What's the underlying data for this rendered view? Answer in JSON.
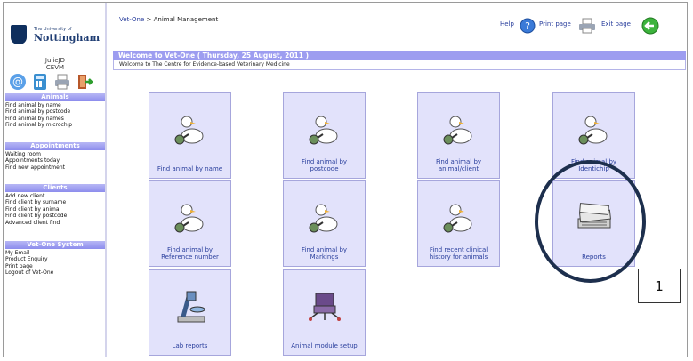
{
  "logo": {
    "small": "The University of",
    "big": "Nottingham"
  },
  "user": {
    "name": "JulieJD",
    "dept": "CEVM"
  },
  "quick_icons": [
    "email-icon",
    "calculator-icon",
    "printer-icon",
    "logout-icon"
  ],
  "sidebar": {
    "sections": [
      {
        "title": "Animals",
        "items": [
          "Find animal by name",
          "Find animal by postcode",
          "Find animal by names",
          "Find animal by microchip"
        ]
      },
      {
        "title": "Appointments",
        "items": [
          "Waiting room",
          "Appointments today",
          "Find new appointment"
        ]
      },
      {
        "title": "Clients",
        "items": [
          "Add new client",
          "Find client by surname",
          "Find client by animal",
          "Find client by postcode",
          "Advanced client find"
        ]
      },
      {
        "title": "Vet-One System",
        "items": [
          "My Email",
          "Product Enquiry",
          "Print page",
          "Logout of Vet-One"
        ]
      }
    ]
  },
  "breadcrumb": {
    "link": "Vet-One",
    "sep": ">",
    "current": "Animal Management"
  },
  "toplinks": {
    "help": "Help",
    "print": "Print page",
    "exit": "Exit page"
  },
  "welcome": {
    "title": "Welcome to Vet-One ( Thursday, 25 August, 2011 )",
    "message": "Welcome to The Centre for Evidence-based Veterinary Medicine"
  },
  "tiles": [
    {
      "line1": "Find animal by name",
      "line2": "",
      "icon": "duck-magnifier-icon"
    },
    {
      "line1": "Find animal by",
      "line2": "postcode",
      "icon": "duck-magnifier-icon"
    },
    {
      "line1": "Find animal by",
      "line2": "animal/client",
      "icon": "duck-magnifier-icon"
    },
    {
      "line1": "Find animal by",
      "line2": "Identichip",
      "icon": "duck-magnifier-icon"
    },
    {
      "line1": "Find animal by",
      "line2": "Reference number",
      "icon": "duck-magnifier-icon"
    },
    {
      "line1": "Find animal by",
      "line2": "Markings",
      "icon": "duck-magnifier-icon"
    },
    {
      "line1": "Find recent clinical",
      "line2": "history for animals",
      "icon": "duck-magnifier-icon"
    },
    {
      "line1": "Reports",
      "line2": "",
      "icon": "reports-icon"
    },
    {
      "line1": "Lab reports",
      "line2": "",
      "icon": "microscope-icon"
    },
    {
      "line1": "Animal module setup",
      "line2": "",
      "icon": "setup-icon"
    }
  ],
  "callout": "1",
  "colors": {
    "accent": "#9d9df0",
    "tile_bg": "#e2e2fb",
    "link": "#2a3f9d",
    "circle": "#1d2f4d"
  }
}
